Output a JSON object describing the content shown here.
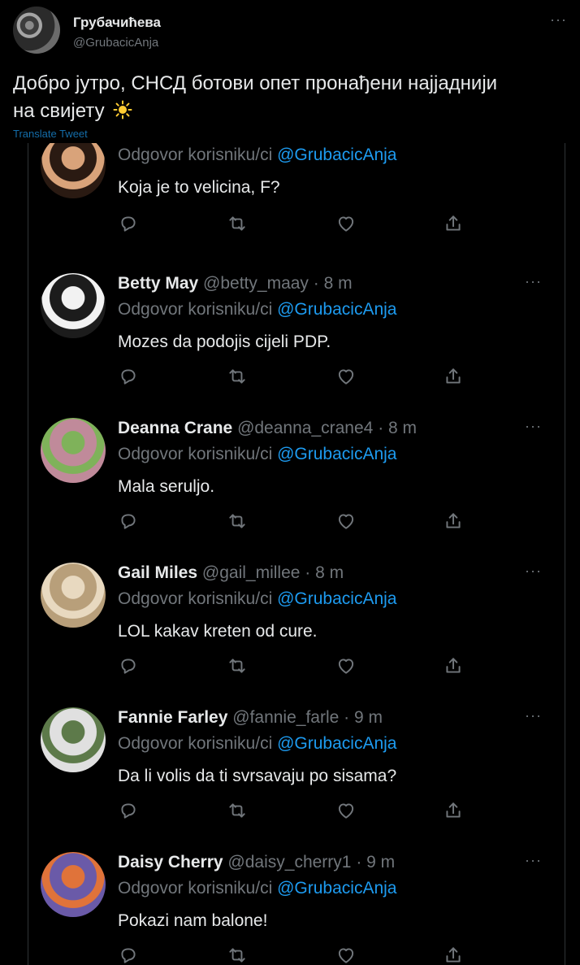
{
  "colors": {
    "background": "#000000",
    "text": "#e7e9ea",
    "muted": "#71767b",
    "accent": "#1d9bf0",
    "divider": "#2f3336"
  },
  "main_tweet": {
    "name": "Грубачићева",
    "handle": "@GrubacicAnja",
    "more": "···",
    "text": "Добро јутро, СНСД ботови опет пронађени најјаднији на свијету",
    "emoji": "sun-icon",
    "translate": "Translate Tweet"
  },
  "replies": [
    {
      "name": "",
      "handle": "",
      "time": "",
      "replying_prefix": "Odgovor korisniku/ci",
      "mention": "@GrubacicAnja",
      "text": "Koja je to velicina, F?",
      "avatar_colors": [
        "#d9a37a",
        "#2a1a12"
      ]
    },
    {
      "name": "Betty May",
      "handle": "@betty_maay",
      "time": "8 m",
      "replying_prefix": "Odgovor korisniku/ci",
      "mention": "@GrubacicAnja",
      "text": "Mozes da podojis cijeli PDP.",
      "avatar_colors": [
        "#f2f2f2",
        "#1c1c1c"
      ]
    },
    {
      "name": "Deanna Crane",
      "handle": "@deanna_crane4",
      "time": "8 m",
      "replying_prefix": "Odgovor korisniku/ci",
      "mention": "@GrubacicAnja",
      "text": "Mala seruljo.",
      "avatar_colors": [
        "#7fb25a",
        "#c08a9a"
      ]
    },
    {
      "name": "Gail Miles",
      "handle": "@gail_millee",
      "time": "8 m",
      "replying_prefix": "Odgovor korisniku/ci",
      "mention": "@GrubacicAnja",
      "text": "LOL kakav kreten od cure.",
      "avatar_colors": [
        "#e8d9c0",
        "#b89f7a"
      ]
    },
    {
      "name": "Fannie Farley",
      "handle": "@fannie_farle",
      "time": "9 m",
      "replying_prefix": "Odgovor korisniku/ci",
      "mention": "@GrubacicAnja",
      "text": "Da li volis da ti svrsavaju po sisama?",
      "avatar_colors": [
        "#5d7a4a",
        "#e0e0e0"
      ]
    },
    {
      "name": "Daisy Cherry",
      "handle": "@daisy_cherry1",
      "time": "9 m",
      "replying_prefix": "Odgovor korisniku/ci",
      "mention": "@GrubacicAnja",
      "text": "Pokazi nam balone!",
      "avatar_colors": [
        "#e0733a",
        "#6a5aa8"
      ]
    }
  ]
}
